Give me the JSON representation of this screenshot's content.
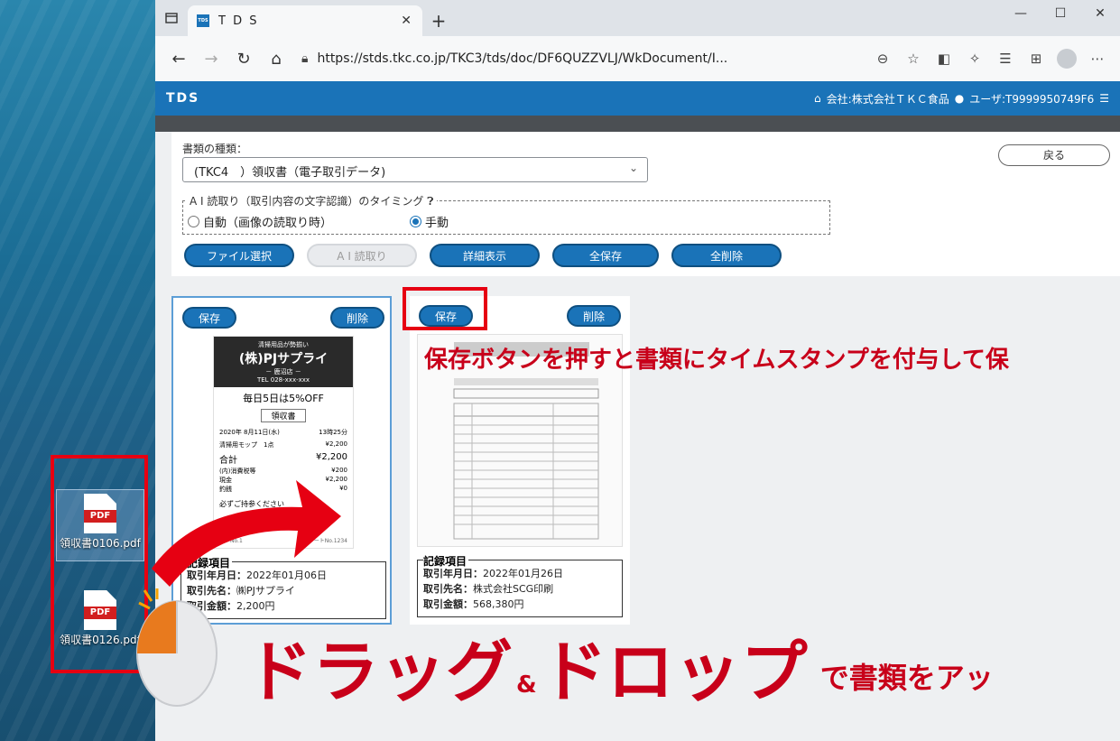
{
  "desktop": {
    "icons": [
      {
        "label": "領収書0106.pdf",
        "file_tag": "PDF"
      },
      {
        "label": "領収書0126.pdf",
        "file_tag": "PDF"
      }
    ]
  },
  "browser": {
    "tab_title": "T D S",
    "tab_favicon": "TDS",
    "url": "https://stds.tkc.co.jp/TKC3/tds/doc/DF6QUZZVLJ/WkDocument/I..."
  },
  "app": {
    "brand": "TDS",
    "company": "会社:株式会社ＴＫＣ食品",
    "user": "ユーザ:T9999950749F6"
  },
  "form": {
    "doc_type_label": "書類の種類：",
    "doc_type_value": "(TKC4　）領収書（電子取引データ)",
    "back_label": "戻る",
    "ai_legend": "A I 読取り（取引内容の文字認識）のタイミング",
    "radio_auto": "自動（画像の読取り時）",
    "radio_manual": "手動",
    "buttons": {
      "file_select": "ファイル選択",
      "ai_read": "A I 読取り",
      "detail": "詳細表示",
      "save_all": "全保存",
      "delete_all": "全削除"
    }
  },
  "cards": [
    {
      "save": "保存",
      "delete": "削除",
      "receipt": {
        "tagline": "清掃用品が勢揃い",
        "shop": "(株)PJサプライ",
        "branch": "－ 鹿沼店 －",
        "tel": "TEL 028-xxx-xxx",
        "promo": "毎日5日は5%OFF",
        "doc_title": "領収書",
        "date": "2020年 8月11日(水)",
        "time": "13時25分",
        "item": "清掃用モップ　1点",
        "item_price": "¥2,200",
        "total_label": "合計",
        "total": "¥2,200",
        "tax_label": "(内)消費税等",
        "tax": "¥200",
        "cash_label": "現金",
        "cash": "¥2,200",
        "change_label": "釣銭",
        "change": "¥0",
        "note": "必ずご持参ください",
        "footer_left": "レジNo.1",
        "footer_right": "レシートNo.1234"
      },
      "records_title": "記録項目",
      "fields": [
        {
          "label": "取引年月日：",
          "value": "2022年01月06日"
        },
        {
          "label": "取引先名：",
          "value": "㈱PJサプライ"
        },
        {
          "label": "取引金額：",
          "value": "2,200円"
        }
      ]
    },
    {
      "save": "保存",
      "delete": "削除",
      "records_title": "記録項目",
      "fields": [
        {
          "label": "取引年月日：",
          "value": "2022年01月26日"
        },
        {
          "label": "取引先名：",
          "value": "株式会社SCG印刷"
        },
        {
          "label": "取引金額：",
          "value": "568,380円"
        }
      ]
    }
  ],
  "annotations": {
    "caption": "保存ボタンを押すと書類にタイムスタンプを付与して保",
    "dd_big_1": "ドラッグ",
    "dd_amp": "&",
    "dd_big_2": "ドロップ",
    "dd_rest": "で書類をアッ"
  }
}
